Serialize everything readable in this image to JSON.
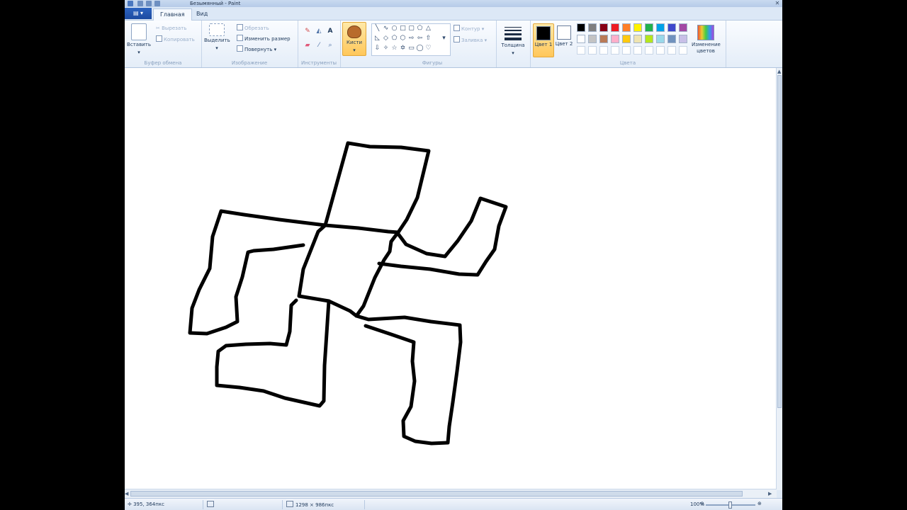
{
  "app": {
    "title": "Безымянный - Paint",
    "file_menu_label": "▤ ▾",
    "close_glyph": "✕"
  },
  "tabs": [
    {
      "label": "Главная"
    },
    {
      "label": "Вид"
    }
  ],
  "ribbon": {
    "clipboard": {
      "label": "Буфер обмена",
      "paste": "Вставить",
      "cut": "Вырезать",
      "copy": "Копировать"
    },
    "image": {
      "label": "Изображение",
      "select": "Выделить",
      "crop": "Обрезать",
      "resize": "Изменить размер",
      "rotate": "Повернуть ▾"
    },
    "tools": {
      "label": "Инструменты",
      "brushes": "Кисти",
      "text_glyph": "A"
    },
    "shapes": {
      "label": "Фигуры",
      "outline": "Контур ▾",
      "fill": "Заливка ▾"
    },
    "thickness": {
      "label": "Толщина"
    },
    "colors": {
      "label": "Цвета",
      "color1": "Цвет 1",
      "color2": "Цвет 2",
      "edit_colors": "Изменение цветов",
      "color1_value": "#000000",
      "color2_value": "#ffffff",
      "palette_row1": [
        "#000000",
        "#7f7f7f",
        "#880015",
        "#ed1c24",
        "#ff7f27",
        "#fff200",
        "#22b14c",
        "#00a2e8",
        "#3f48cc",
        "#a349a4"
      ],
      "palette_row2": [
        "#ffffff",
        "#c3c3c3",
        "#b97a57",
        "#ffaec9",
        "#ffc90e",
        "#efe4b0",
        "#b5e61d",
        "#99d9ea",
        "#7092be",
        "#c8bfe7"
      ],
      "palette_row3": [
        "#ffffff",
        "#ffffff",
        "#ffffff",
        "#ffffff",
        "#ffffff",
        "#ffffff",
        "#ffffff",
        "#ffffff",
        "#ffffff",
        "#ffffff"
      ]
    }
  },
  "canvas": {
    "stroke_color": "#000000"
  },
  "status": {
    "cursor_pos": "395, 364пкс",
    "image_size": "1298 × 986пкс",
    "zoom": "100%",
    "zoom_minus": "⊖",
    "zoom_plus": "⊕"
  }
}
